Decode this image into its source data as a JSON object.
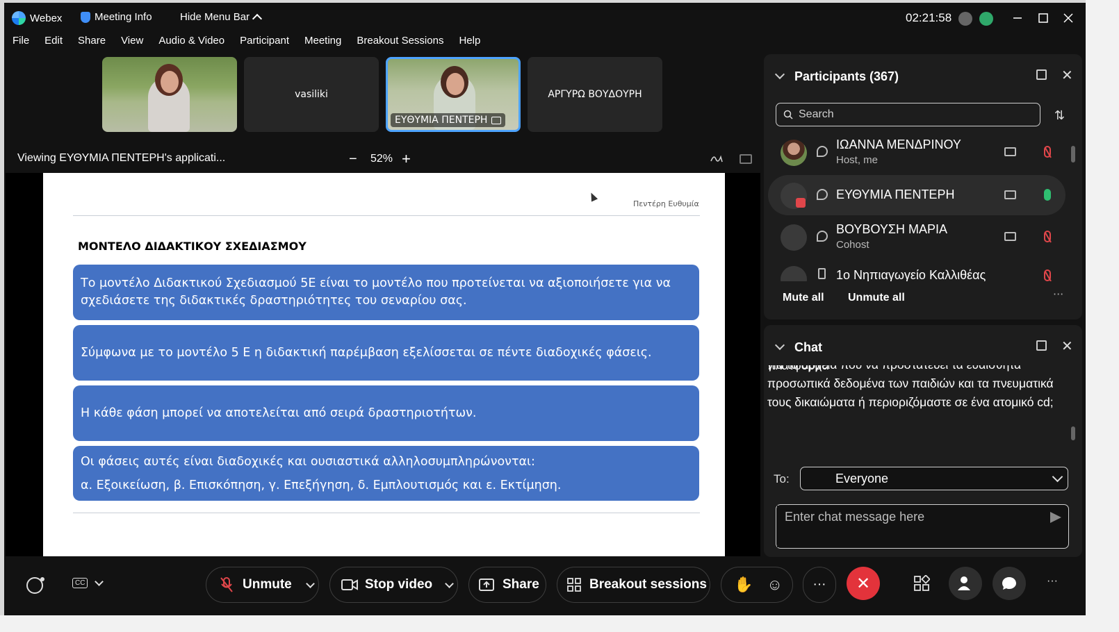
{
  "window": {
    "app_name": "Webex",
    "meeting_info": "Meeting Info",
    "hide_menu_bar": "Hide Menu Bar",
    "clock": "02:21:58"
  },
  "menu": [
    "File",
    "Edit",
    "Share",
    "View",
    "Audio & Video",
    "Participant",
    "Meeting",
    "Breakout Sessions",
    "Help"
  ],
  "thumbnails": [
    {
      "name": "",
      "type": "video"
    },
    {
      "name": "vasiliki",
      "type": "name"
    },
    {
      "name": "ΕΥΘΥΜΙΑ ΠΕΝΤΕΡΗ",
      "type": "video-active"
    },
    {
      "name": "ΑΡΓΥΡΩ ΒΟΥΔΟΥΡΗ",
      "type": "name"
    }
  ],
  "viewing": {
    "text": "Viewing ΕΥΘΥΜΙΑ ΠΕΝΤΕΡΗ's applicati...",
    "zoom_minus": "−",
    "zoom": "52%",
    "zoom_plus": "+"
  },
  "slide": {
    "author": "Πεντέρη Ευθυμία",
    "title": "ΜΟΝΤΕΛΟ ΔΙΔΑΚΤΙΚΟΥ ΣΧΕΔΙΑΣΜΟΥ",
    "box1": "Το μοντέλο Διδακτικού Σχεδιασμού 5Ε είναι το μοντέλο που προτείνεται να αξιοποιήσετε για να σχεδιάσετε της διδακτικές δραστηριότητες του σεναρίου σας.",
    "box2": "Σύμφωνα με το μοντέλο 5 Ε η διδακτική παρέμβαση εξελίσσεται σε πέντε διαδοχικές φάσεις.",
    "box3": "Η κάθε φάση μπορεί να αποτελείται από σειρά δραστηριοτήτων.",
    "box4_line1": "Οι φάσεις αυτές είναι διαδοχικές και ουσιαστικά αλληλοσυμπληρώνονται:",
    "box4_line2": "α. Εξοικείωση, β. Επισκόπηση, γ. Επεξήγηση, δ. Εμπλουτισμός και ε. Εκτίμηση."
  },
  "participants": {
    "title": "Participants (367)",
    "search_placeholder": "Search",
    "list": [
      {
        "name": "ΙΩΑΝΝΑ ΜΕΝΔΡΙΝΟΥ",
        "role": "Host, me",
        "mic": "muted"
      },
      {
        "name": "ΕΥΘΥΜΙΑ ΠΕΝΤΕΡΗ",
        "role": "",
        "mic": "on"
      },
      {
        "name": "ΒΟΥΒΟΥΣΗ ΜΑΡΙΑ",
        "role": "Cohost",
        "mic": "muted"
      },
      {
        "name": "1ο Νηπιαγωγείο Καλλιθέας",
        "role": "",
        "mic": "muted"
      }
    ],
    "mute_all": "Mute all",
    "unmute_all": "Unmute all",
    "more": "···"
  },
  "chat": {
    "title": "Chat",
    "message_partial": "αξιολόγησης; Υπάρχει ασφαλής ηλεκτρονική πλατφόρμα",
    "message": "για τα αρχεία που να προστατεύει τα ευαίσθητα προσωπικά δεδομένα των παιδιών  και τα πνευματικά τους δικαιώματα ή περιοριζόμαστε σε ένα ατομικό cd;",
    "to_label": "To:",
    "to_value": "Everyone",
    "input_placeholder": "Enter chat message here"
  },
  "controls": {
    "cc": "CC",
    "unmute": "Unmute",
    "stop_video": "Stop video",
    "share": "Share",
    "breakout": "Breakout sessions",
    "more": "···",
    "end": "✕"
  },
  "colors": {
    "accent": "#4da3ff",
    "slide_box": "#4472c4",
    "end_call": "#e3333b",
    "mic_on": "#2fbf71",
    "mic_muted": "#e0464a"
  }
}
